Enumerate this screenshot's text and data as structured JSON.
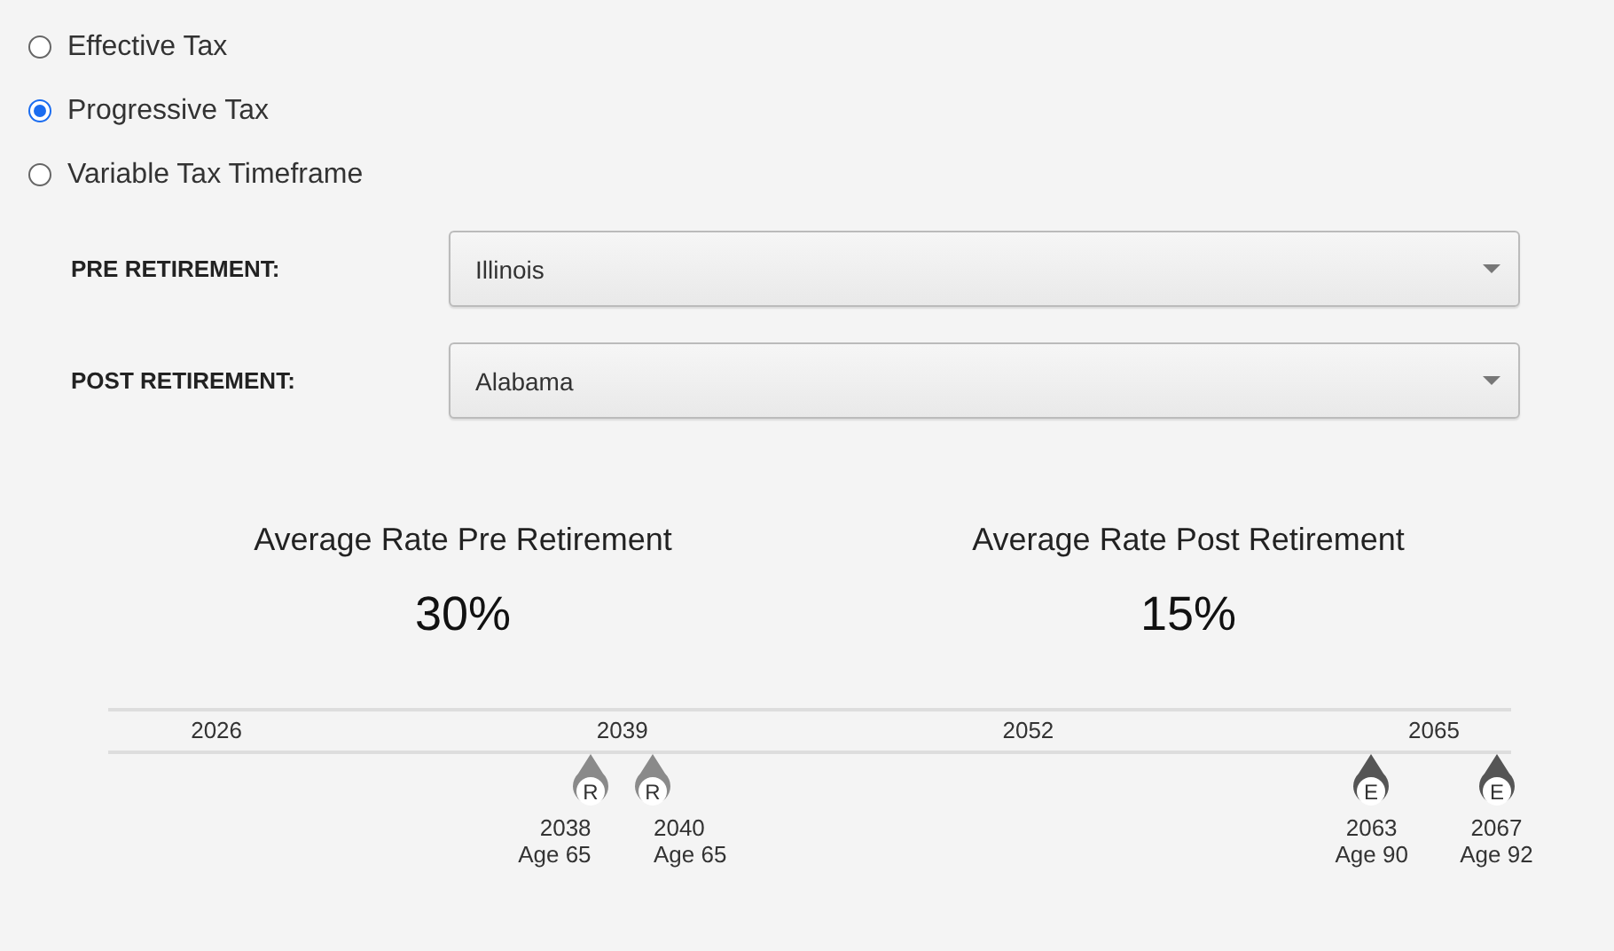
{
  "tax_options": [
    {
      "label": "Effective Tax",
      "selected": false
    },
    {
      "label": "Progressive Tax",
      "selected": true
    },
    {
      "label": "Variable Tax Timeframe",
      "selected": false
    }
  ],
  "state_selects": [
    {
      "label": "PRE RETIREMENT:",
      "value": "Illinois"
    },
    {
      "label": "POST RETIREMENT:",
      "value": "Alabama"
    }
  ],
  "averages": [
    {
      "title": "Average Rate Pre Retirement",
      "value": "30%"
    },
    {
      "title": "Average Rate Post Retirement",
      "value": "15%"
    }
  ],
  "timeline": {
    "ticks": [
      "2026",
      "2039",
      "2052",
      "2065"
    ],
    "markers": [
      {
        "kind": "retirement",
        "letter": "R",
        "year": "2038",
        "age": "Age 65"
      },
      {
        "kind": "retirement",
        "letter": "R",
        "year": "2040",
        "age": "Age 65"
      },
      {
        "kind": "end",
        "letter": "E",
        "year": "2063",
        "age": "Age 90"
      },
      {
        "kind": "end",
        "letter": "E",
        "year": "2067",
        "age": "Age 92"
      }
    ]
  }
}
